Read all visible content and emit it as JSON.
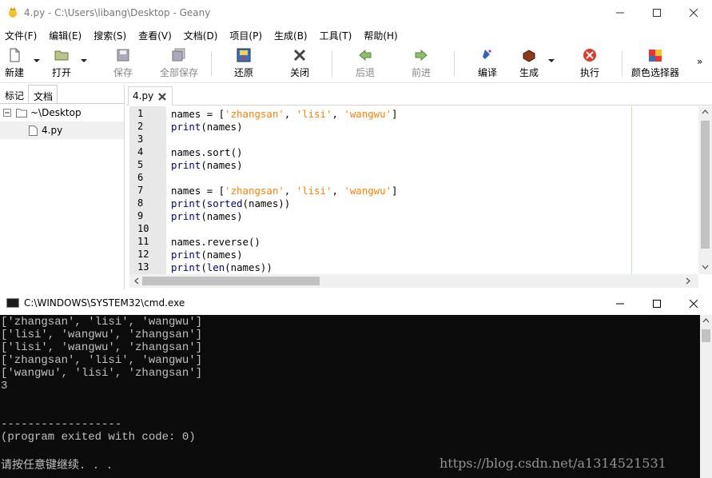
{
  "geany": {
    "title": "4.py - C:\\Users\\libang\\Desktop - Geany",
    "menu": [
      "文件(F)",
      "编辑(E)",
      "搜索(S)",
      "查看(V)",
      "文档(D)",
      "项目(P)",
      "生成(B)",
      "工具(T)",
      "帮助(H)"
    ],
    "toolbar": {
      "new": "新建",
      "open": "打开",
      "save": "保存",
      "save_all": "全部保存",
      "revert": "还原",
      "close": "关闭",
      "back": "后退",
      "forward": "前进",
      "compile": "编译",
      "build": "生成",
      "execute": "执行",
      "color_chooser": "颜色选择器",
      "overflow": "»"
    },
    "sidebar": {
      "tabs": [
        "标记",
        "文档"
      ],
      "folder": "~\\Desktop",
      "file": "4.py"
    },
    "doc_tab": "4.py",
    "code": [
      [
        "n",
        "names = ['zhangsan', 'lisi', 'wangwu']"
      ],
      [
        "p",
        "print(names)"
      ],
      [
        "e",
        ""
      ],
      [
        "n",
        "names.sort()"
      ],
      [
        "p",
        "print(names)"
      ],
      [
        "e",
        ""
      ],
      [
        "n",
        "names = ['zhangsan', 'lisi', 'wangwu']"
      ],
      [
        "p",
        "print(sorted(names))"
      ],
      [
        "p",
        "print(names)"
      ],
      [
        "e",
        ""
      ],
      [
        "n",
        "names.reverse()"
      ],
      [
        "p",
        "print(names)"
      ],
      [
        "p",
        "print(len(names))"
      ]
    ],
    "line_numbers": [
      "1",
      "2",
      "3",
      "4",
      "5",
      "6",
      "7",
      "8",
      "9",
      "10",
      "11",
      "12",
      "13"
    ]
  },
  "cmd": {
    "title": "C:\\WINDOWS\\SYSTEM32\\cmd.exe",
    "lines": [
      "['zhangsan', 'lisi', 'wangwu']",
      "['lisi', 'wangwu', 'zhangsan']",
      "['lisi', 'wangwu', 'zhangsan']",
      "['zhangsan', 'lisi', 'wangwu']",
      "['wangwu', 'lisi', 'zhangsan']",
      "3",
      "",
      "",
      "------------------",
      "(program exited with code: 0)",
      "",
      "请按任意键继续. . ."
    ],
    "watermark": "https://blog.csdn.net/a1314521531"
  },
  "colors": {
    "keyword": "#00007f",
    "string": "#ff8000",
    "console_bg": "#0c0c0c",
    "console_fg": "#c0c0c0"
  }
}
